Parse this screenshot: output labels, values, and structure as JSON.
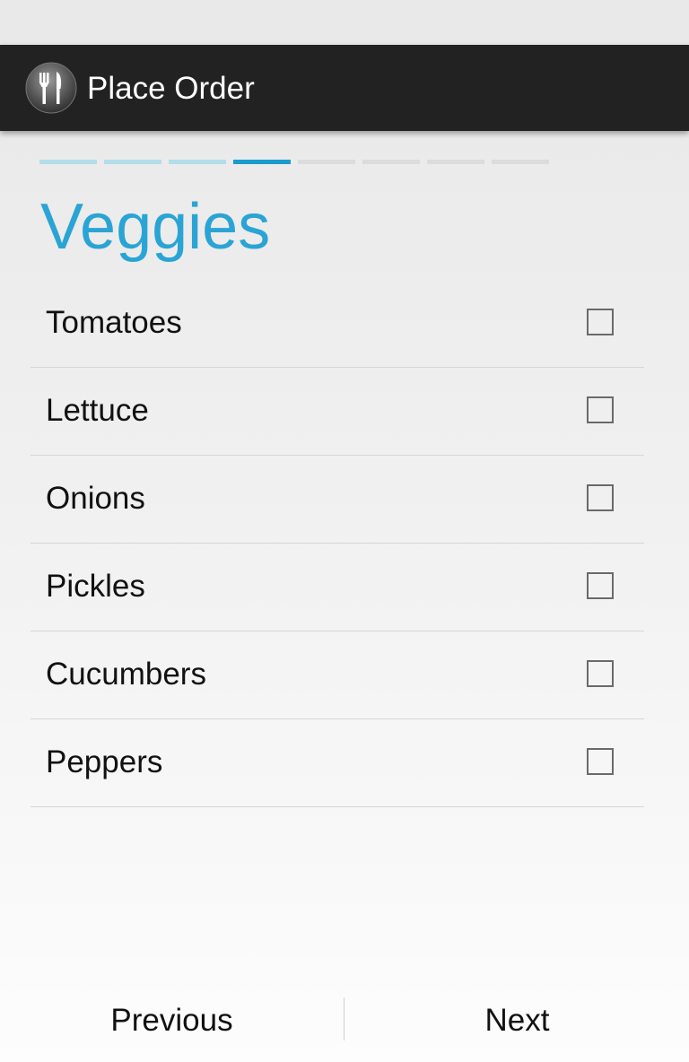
{
  "action_bar": {
    "title": "Place Order",
    "icon": "fork-knife-icon",
    "background": "#222222"
  },
  "wizard": {
    "total_steps": 8,
    "current_step": 4,
    "step_states": [
      "done",
      "done",
      "done",
      "current",
      "pending",
      "pending",
      "pending",
      "pending"
    ]
  },
  "page": {
    "title": "Veggies",
    "accent_color": "#2aa4d4"
  },
  "veggies": [
    {
      "label": "Tomatoes",
      "checked": false
    },
    {
      "label": "Lettuce",
      "checked": false
    },
    {
      "label": "Onions",
      "checked": false
    },
    {
      "label": "Pickles",
      "checked": false
    },
    {
      "label": "Cucumbers",
      "checked": false
    },
    {
      "label": "Peppers",
      "checked": false
    }
  ],
  "footer": {
    "previous_label": "Previous",
    "next_label": "Next"
  }
}
